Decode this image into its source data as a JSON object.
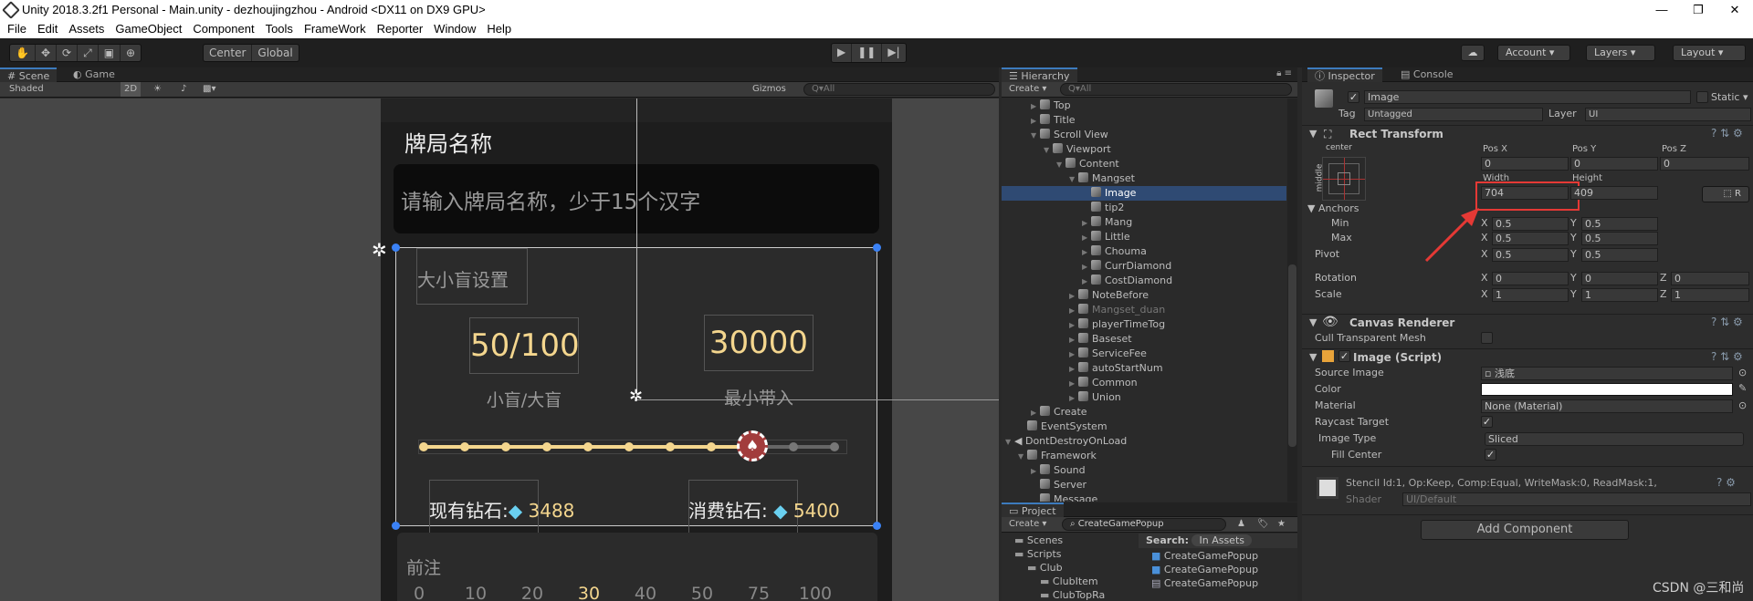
{
  "window": {
    "title": "Unity 2018.3.2f1 Personal - Main.unity - dezhoujingzhou - Android <DX11 on DX9 GPU>"
  },
  "menu": [
    "File",
    "Edit",
    "Assets",
    "GameObject",
    "Component",
    "Tools",
    "FrameWork",
    "Reporter",
    "Window",
    "Help"
  ],
  "toolbar": {
    "tools": [
      "hand-tool",
      "move-tool",
      "rotate-tool",
      "scale-tool",
      "rect-tool",
      "transform-tool"
    ],
    "pivot": "Center",
    "space": "Global",
    "account": "Account",
    "layers": "Layers",
    "layout": "Layout"
  },
  "scene": {
    "tabs": [
      "Scene",
      "Game"
    ],
    "shading": "Shaded",
    "mode2d": "2D",
    "gizmos": "Gizmos",
    "search_placeholder": "All",
    "game": {
      "title": "牌局名称",
      "input_placeholder": "请输入牌局名称，少于15个汉字",
      "blind_header": "大小盲设置",
      "blind_value": "50/100",
      "blind_label": "小盲/大盲",
      "min_buyin_value": "30000",
      "min_buyin_label": "最小带入",
      "slider_level_index": 8,
      "slider_steps": 11,
      "current_diamond_label": "现有钻石:",
      "current_diamond_value": "3488",
      "cost_diamond_label": "消费钻石:",
      "cost_diamond_value": "5400",
      "ante_title": "前注",
      "ante_options": [
        "0",
        "10",
        "20",
        "30",
        "40",
        "50",
        "75",
        "100"
      ],
      "ante_selected": "30"
    }
  },
  "hierarchy": {
    "tab": "Hierarchy",
    "create": "Create",
    "search_placeholder": "All",
    "items": [
      {
        "label": "Top",
        "depth": 2,
        "arrow": "right"
      },
      {
        "label": "Title",
        "depth": 2,
        "arrow": "right"
      },
      {
        "label": "Scroll View",
        "depth": 2,
        "arrow": "down"
      },
      {
        "label": "Viewport",
        "depth": 3,
        "arrow": "down"
      },
      {
        "label": "Content",
        "depth": 4,
        "arrow": "down"
      },
      {
        "label": "Mangset",
        "depth": 5,
        "arrow": "down"
      },
      {
        "label": "Image",
        "depth": 6,
        "arrow": "",
        "selected": true
      },
      {
        "label": "tip2",
        "depth": 6,
        "arrow": ""
      },
      {
        "label": "Mang",
        "depth": 6,
        "arrow": "right"
      },
      {
        "label": "Little",
        "depth": 6,
        "arrow": "right"
      },
      {
        "label": "Chouma",
        "depth": 6,
        "arrow": "right"
      },
      {
        "label": "CurrDiamond",
        "depth": 6,
        "arrow": "right"
      },
      {
        "label": "CostDiamond",
        "depth": 6,
        "arrow": "right"
      },
      {
        "label": "NoteBefore",
        "depth": 5,
        "arrow": "right"
      },
      {
        "label": "Mangset_duan",
        "depth": 5,
        "arrow": "right",
        "inactive": true
      },
      {
        "label": "playerTimeTog",
        "depth": 5,
        "arrow": "right"
      },
      {
        "label": "Baseset",
        "depth": 5,
        "arrow": "right"
      },
      {
        "label": "ServiceFee",
        "depth": 5,
        "arrow": "right"
      },
      {
        "label": "autoStartNum",
        "depth": 5,
        "arrow": "right"
      },
      {
        "label": "Common",
        "depth": 5,
        "arrow": "right"
      },
      {
        "label": "Union",
        "depth": 5,
        "arrow": "right"
      },
      {
        "label": "Create",
        "depth": 2,
        "arrow": "right"
      },
      {
        "label": "EventSystem",
        "depth": 1,
        "arrow": ""
      },
      {
        "label": "DontDestroyOnLoad",
        "depth": 0,
        "arrow": "down",
        "scene": true
      },
      {
        "label": "Framework",
        "depth": 1,
        "arrow": "down"
      },
      {
        "label": "Sound",
        "depth": 2,
        "arrow": "right"
      },
      {
        "label": "Server",
        "depth": 2,
        "arrow": ""
      },
      {
        "label": "Message",
        "depth": 2,
        "arrow": ""
      }
    ]
  },
  "project": {
    "tab": "Project",
    "create": "Create",
    "search_value": "CreateGamePopup",
    "search_scope_label": "Search:",
    "search_scope": "In Assets",
    "folders": [
      {
        "label": "Scenes",
        "depth": 1
      },
      {
        "label": "Scripts",
        "depth": 1
      },
      {
        "label": "Club",
        "depth": 2
      },
      {
        "label": "ClubItem",
        "depth": 3
      },
      {
        "label": "ClubTopRa",
        "depth": 3
      }
    ],
    "results": [
      {
        "label": "CreateGamePopup",
        "icon": "prefab-icon"
      },
      {
        "label": "CreateGamePopup",
        "icon": "prefab-icon"
      },
      {
        "label": "CreateGamePopup",
        "icon": "csharp-script-icon"
      }
    ]
  },
  "inspector": {
    "tabs": [
      "Inspector",
      "Console"
    ],
    "object_name": "Image",
    "static_label": "Static",
    "tag_label": "Tag",
    "tag": "Untagged",
    "layer_label": "Layer",
    "layer": "UI",
    "rect_transform": {
      "title": "Rect Transform",
      "anchor_h": "center",
      "anchor_v": "middle",
      "pos_x_label": "Pos X",
      "pos_y_label": "Pos Y",
      "pos_z_label": "Pos Z",
      "pos_x": "0",
      "pos_y": "0",
      "pos_z": "0",
      "width_label": "Width",
      "height_label": "Height",
      "width": "704",
      "height": "409",
      "r_button": "R",
      "anchors_label": "Anchors",
      "min_label": "Min",
      "max_label": "Max",
      "pivot_label": "Pivot",
      "rotation_label": "Rotation",
      "scale_label": "Scale",
      "min_x": "0.5",
      "min_y": "0.5",
      "max_x": "0.5",
      "max_y": "0.5",
      "pivot_x": "0.5",
      "pivot_y": "0.5",
      "rot_x": "0",
      "rot_y": "0",
      "rot_z": "0",
      "scale_x": "1",
      "scale_y": "1",
      "scale_z": "1"
    },
    "canvas_renderer": {
      "title": "Canvas Renderer",
      "cull_label": "Cull Transparent Mesh",
      "cull": false
    },
    "image": {
      "title": "Image (Script)",
      "source_label": "Source Image",
      "source": "浅底",
      "color_label": "Color",
      "color": "#ffffff",
      "material_label": "Material",
      "material": "None (Material)",
      "raycast_label": "Raycast Target",
      "raycast": true,
      "type_label": "Image Type",
      "type": "Sliced",
      "fill_label": "Fill Center",
      "fill": true
    },
    "material_preview": {
      "stencil": "Stencil Id:1, Op:Keep, Comp:Equal, WriteMask:0, ReadMask:1,",
      "shader_label": "Shader",
      "shader": "UI/Default"
    },
    "add_component": "Add Component"
  },
  "watermark": "CSDN @三和尚",
  "colors": {
    "selection": "#2f4a73",
    "accent": "#3d7bbd",
    "gold": "#f4d68e",
    "highlight_box": "#e53935"
  }
}
